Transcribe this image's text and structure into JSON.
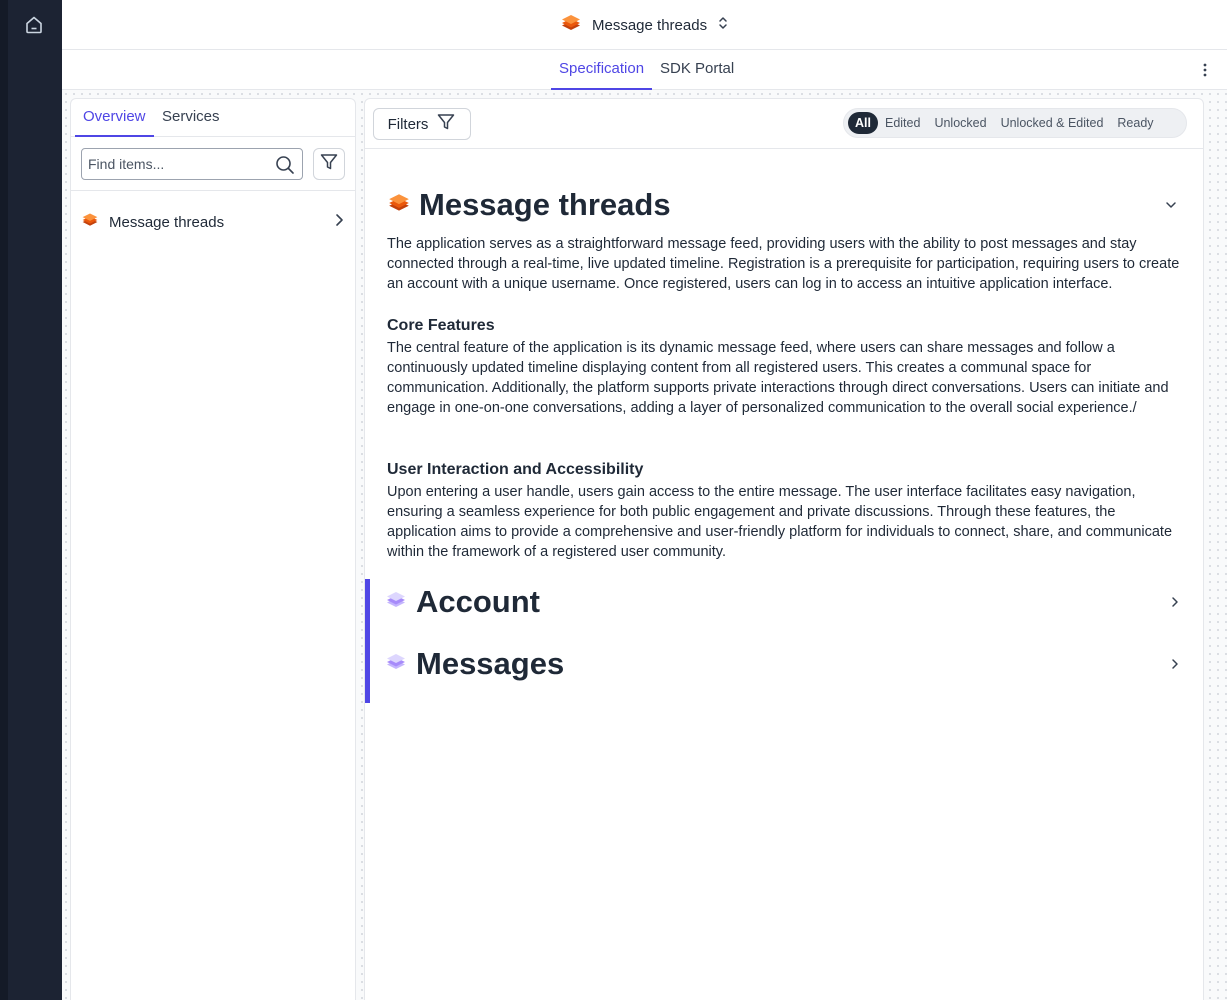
{
  "app": {
    "project_name": "Message threads",
    "icons": {
      "home": "home-icon",
      "project": "stack-orange-icon",
      "switch": "chevron-updown-icon",
      "menu": "kebab-icon"
    }
  },
  "top_tabs": [
    {
      "label": "Specification",
      "active": true
    },
    {
      "label": "SDK Portal",
      "active": false
    }
  ],
  "sidebar": {
    "tabs": [
      {
        "label": "Overview",
        "active": true
      },
      {
        "label": "Services",
        "active": false
      }
    ],
    "search": {
      "placeholder": "Find items...",
      "value": ""
    },
    "items": [
      {
        "label": "Message threads",
        "icon": "stack-orange-icon"
      }
    ]
  },
  "toolbar": {
    "filters_label": "Filters",
    "segments": [
      {
        "label": "All",
        "active": true
      },
      {
        "label": "Edited",
        "active": false
      },
      {
        "label": "Unlocked",
        "active": false
      },
      {
        "label": "Unlocked & Edited",
        "active": false
      },
      {
        "label": "Ready",
        "active": false
      }
    ]
  },
  "spec": {
    "title": "Message threads",
    "intro": "The application serves as a straightforward message feed, providing users with the ability to post messages and stay connected through a real-time, live updated timeline. Registration is a prerequisite for participation, requiring users to create an account with a unique username. Once registered, users can log in to access an intuitive application interface.",
    "sections": [
      {
        "heading": "Core Features",
        "body": "The central feature of the application is its dynamic message feed, where users can share messages and follow a continuously updated timeline displaying content from all registered users. This creates a communal space for communication. Additionally, the platform supports private interactions through direct conversations. Users can initiate and engage in one-on-one conversations, adding a layer of personalized communication to the overall social experience./"
      },
      {
        "heading": "User Interaction and Accessibility",
        "body": "Upon entering a user handle, users gain access to the entire message. The user interface facilitates easy navigation, ensuring a seamless experience for both public engagement and private discussions. Through these features, the application aims to provide a comprehensive and user-friendly platform for individuals to connect, share, and communicate within the framework of a registered user community."
      }
    ],
    "groups": [
      {
        "title": "Account",
        "icon": "stack-purple-icon"
      },
      {
        "title": "Messages",
        "icon": "stack-purple-icon"
      }
    ]
  },
  "colors": {
    "accent": "#4f46e5",
    "rail": "#1c2333",
    "brand_orange": "#f97316",
    "group_purple": "#a78bfa"
  }
}
